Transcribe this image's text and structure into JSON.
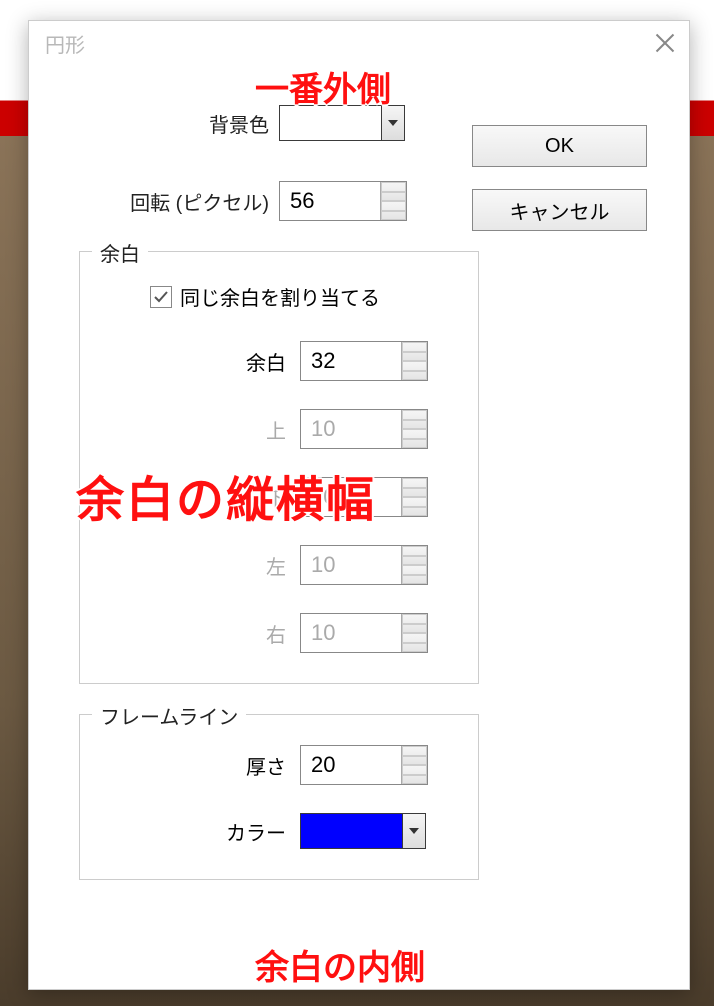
{
  "dialog": {
    "title": "円形",
    "ok_label": "OK",
    "cancel_label": "キャンセル"
  },
  "bgcolor": {
    "label": "背景色",
    "swatch": "#ffffff"
  },
  "rotation": {
    "label": "回転 (ピクセル)",
    "value": "56"
  },
  "margin_group": {
    "legend": "余白",
    "same_margin_label": "同じ余白を割り当てる",
    "same_margin_checked": true,
    "margin": {
      "label": "余白",
      "value": "32"
    },
    "top": {
      "label": "上",
      "value": "10"
    },
    "bottom": {
      "label": "下",
      "value": "40"
    },
    "left": {
      "label": "左",
      "value": "10"
    },
    "right": {
      "label": "右",
      "value": "10"
    }
  },
  "frame_group": {
    "legend": "フレームライン",
    "thickness": {
      "label": "厚さ",
      "value": "20"
    },
    "color": {
      "label": "カラー",
      "swatch": "#0000ff"
    }
  },
  "annotations": {
    "outermost": "一番外側",
    "margin_size": "余白の縦横幅",
    "inside_margin": "余白の内側"
  }
}
